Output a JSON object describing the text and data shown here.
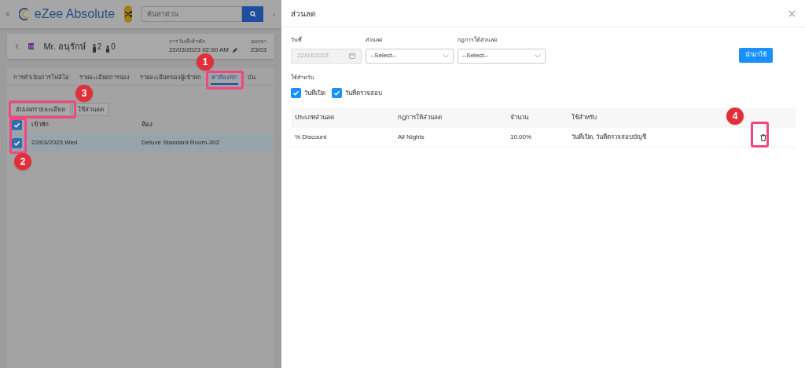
{
  "app_bar": {
    "brand": "eZee Absolute",
    "search": {
      "placeholder": "ค้นหาด่วน"
    }
  },
  "guest": {
    "name": "Mr. อนุรักษ์",
    "adults": "2",
    "children": "0",
    "arrival_label": "การวันที่เข้าพัก",
    "arrival": "22/03/2023 02:00 AM",
    "departure_label": "ออกจา",
    "departure": "23/03"
  },
  "tabs": [
    {
      "label": "การดำเนินการโฟลิโอ",
      "selected": false
    },
    {
      "label": "รายละเอียดการจอง",
      "selected": false
    },
    {
      "label": "รายละเอียดของผู้เข้าพัก",
      "selected": false
    },
    {
      "label": "ค่าห้องพัก",
      "selected": true
    },
    {
      "label": "บัน",
      "selected": false
    }
  ],
  "actions": [
    "อัปเดตรายละเอียด",
    "ใช้ส่วนลด"
  ],
  "stay_table": {
    "columns": [
      "เข้าพัก",
      "ห้อง"
    ],
    "all_checked": true,
    "rows": [
      {
        "checked": true,
        "cells": [
          "22/03/2023 Wed",
          "Deluxe Standard Room-302"
        ]
      }
    ]
  },
  "annotations": [
    {
      "label": "1"
    },
    {
      "label": "2"
    },
    {
      "label": "3"
    },
    {
      "label": "4"
    }
  ],
  "dialog": {
    "title": "ส่วนลด",
    "date": {
      "label": "วันที่",
      "value": "22/03/2023",
      "disabled": true
    },
    "discount": {
      "label": "ส่วนลด",
      "value": "--Select--"
    },
    "rule": {
      "label": "กฎการให้ส่วนลด",
      "value": "--Select--"
    },
    "apply_button": "นำมาใช้",
    "apply_for": {
      "label": "ใช้สำหรับ",
      "options": [
        {
          "label": "วันที่เปิด",
          "checked": true
        },
        {
          "label": "วันที่ตรวจสอบ",
          "checked": true
        }
      ]
    },
    "table": {
      "columns": [
        "ประเภทส่วนลด",
        "กฎการให้ส่วนลด",
        "จำนวน",
        "ใช้สำหรับ"
      ],
      "rows": [
        {
          "cells": [
            "% Discount",
            "All Nights",
            "10.00%",
            "วันที่เปิด, วันที่ตรวจสอบบัญชี"
          ]
        }
      ]
    }
  }
}
